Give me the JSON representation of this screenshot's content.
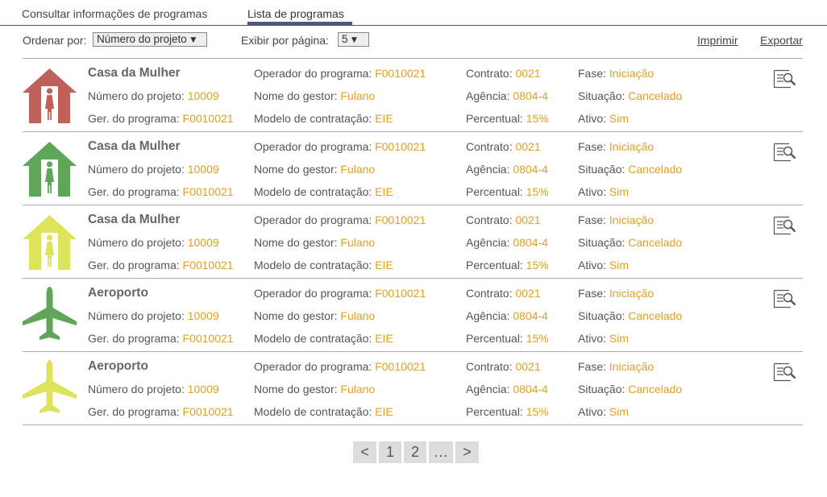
{
  "tabs": [
    {
      "label": "Consultar informações de programas"
    },
    {
      "label": "Lista de programas"
    }
  ],
  "toolbar": {
    "order_label": "Ordenar por:",
    "order_value": "Número do projeto",
    "per_page_label": "Exibir por página:",
    "per_page_value": "5",
    "print_label": "Imprimir",
    "export_label": "Exportar"
  },
  "field_labels": {
    "numero": "Número do projeto:",
    "gerente": "Ger. do programa:",
    "operador": "Operador do programa:",
    "gestor": "Nome do gestor:",
    "modelo": "Modelo de contratação:",
    "contrato": "Contrato:",
    "agencia": "Agência:",
    "percentual": "Percentual:",
    "fase": "Fase:",
    "situacao": "Situação:",
    "ativo": "Ativo:"
  },
  "rows": [
    {
      "title": "Casa da Mulher",
      "icon": "house-woman-icon",
      "color": "#c0605a",
      "numero": "10009",
      "gerente": "F0010021",
      "operador": "F0010021",
      "gestor": "Fulano",
      "modelo": "EIE",
      "contrato": "0021",
      "agencia": "0804-4",
      "percentual": "15%",
      "fase": "Iniciação",
      "situacao": "Cancelado",
      "ativo": "Sim"
    },
    {
      "title": "Casa da Mulher",
      "icon": "house-woman-icon",
      "color": "#5fa55a",
      "numero": "10009",
      "gerente": "F0010021",
      "operador": "F0010021",
      "gestor": "Fulano",
      "modelo": "EIE",
      "contrato": "0021",
      "agencia": "0804-4",
      "percentual": "15%",
      "fase": "Iniciação",
      "situacao": "Cancelado",
      "ativo": "Sim"
    },
    {
      "title": "Casa da Mulher",
      "icon": "house-woman-icon",
      "color": "#dde35a",
      "numero": "10009",
      "gerente": "F0010021",
      "operador": "F0010021",
      "gestor": "Fulano",
      "modelo": "EIE",
      "contrato": "0021",
      "agencia": "0804-4",
      "percentual": "15%",
      "fase": "Iniciação",
      "situacao": "Cancelado",
      "ativo": "Sim"
    },
    {
      "title": "Aeroporto",
      "icon": "airplane-icon",
      "color": "#5fa55a",
      "numero": "10009",
      "gerente": "F0010021",
      "operador": "F0010021",
      "gestor": "Fulano",
      "modelo": "EIE",
      "contrato": "0021",
      "agencia": "0804-4",
      "percentual": "15%",
      "fase": "Iniciação",
      "situacao": "Cancelado",
      "ativo": "Sim"
    },
    {
      "title": "Aeroporto",
      "icon": "airplane-icon",
      "color": "#dde35a",
      "numero": "10009",
      "gerente": "F0010021",
      "operador": "F0010021",
      "gestor": "Fulano",
      "modelo": "EIE",
      "contrato": "0021",
      "agencia": "0804-4",
      "percentual": "15%",
      "fase": "Iniciação",
      "situacao": "Cancelado",
      "ativo": "Sim"
    }
  ],
  "pagination": {
    "prev": "<",
    "pages": [
      "1",
      "2"
    ],
    "more": "…",
    "next": ">"
  },
  "colors": {
    "accent": "#e0a020",
    "tab_underline": "#4a5a7a"
  }
}
